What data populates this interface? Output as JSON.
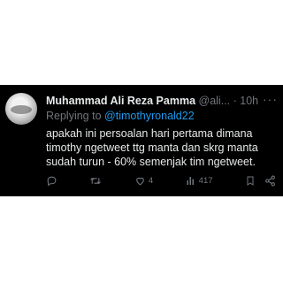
{
  "tweet": {
    "author_name": "Muhammad Ali Reza Pamma",
    "handle": "@ali...",
    "separator": "·",
    "time": "10h",
    "replying_prefix": "Replying to",
    "replying_mention": "@timothyronald22",
    "text": "apakah ini persoalan hari pertama dimana timothy ngetweet ttg manta dan skrg manta sudah turun - 60% semenjak tim ngetweet.",
    "likes": "4",
    "views": "417"
  },
  "icons": {
    "more": "more-icon",
    "reply": "reply-icon",
    "retweet": "retweet-icon",
    "like": "heart-icon",
    "views": "views-icon",
    "bookmark": "bookmark-icon",
    "share": "share-icon"
  },
  "colors": {
    "background": "#000000",
    "text": "#e7e9ea",
    "muted": "#71767b",
    "link": "#1d9bf0"
  }
}
